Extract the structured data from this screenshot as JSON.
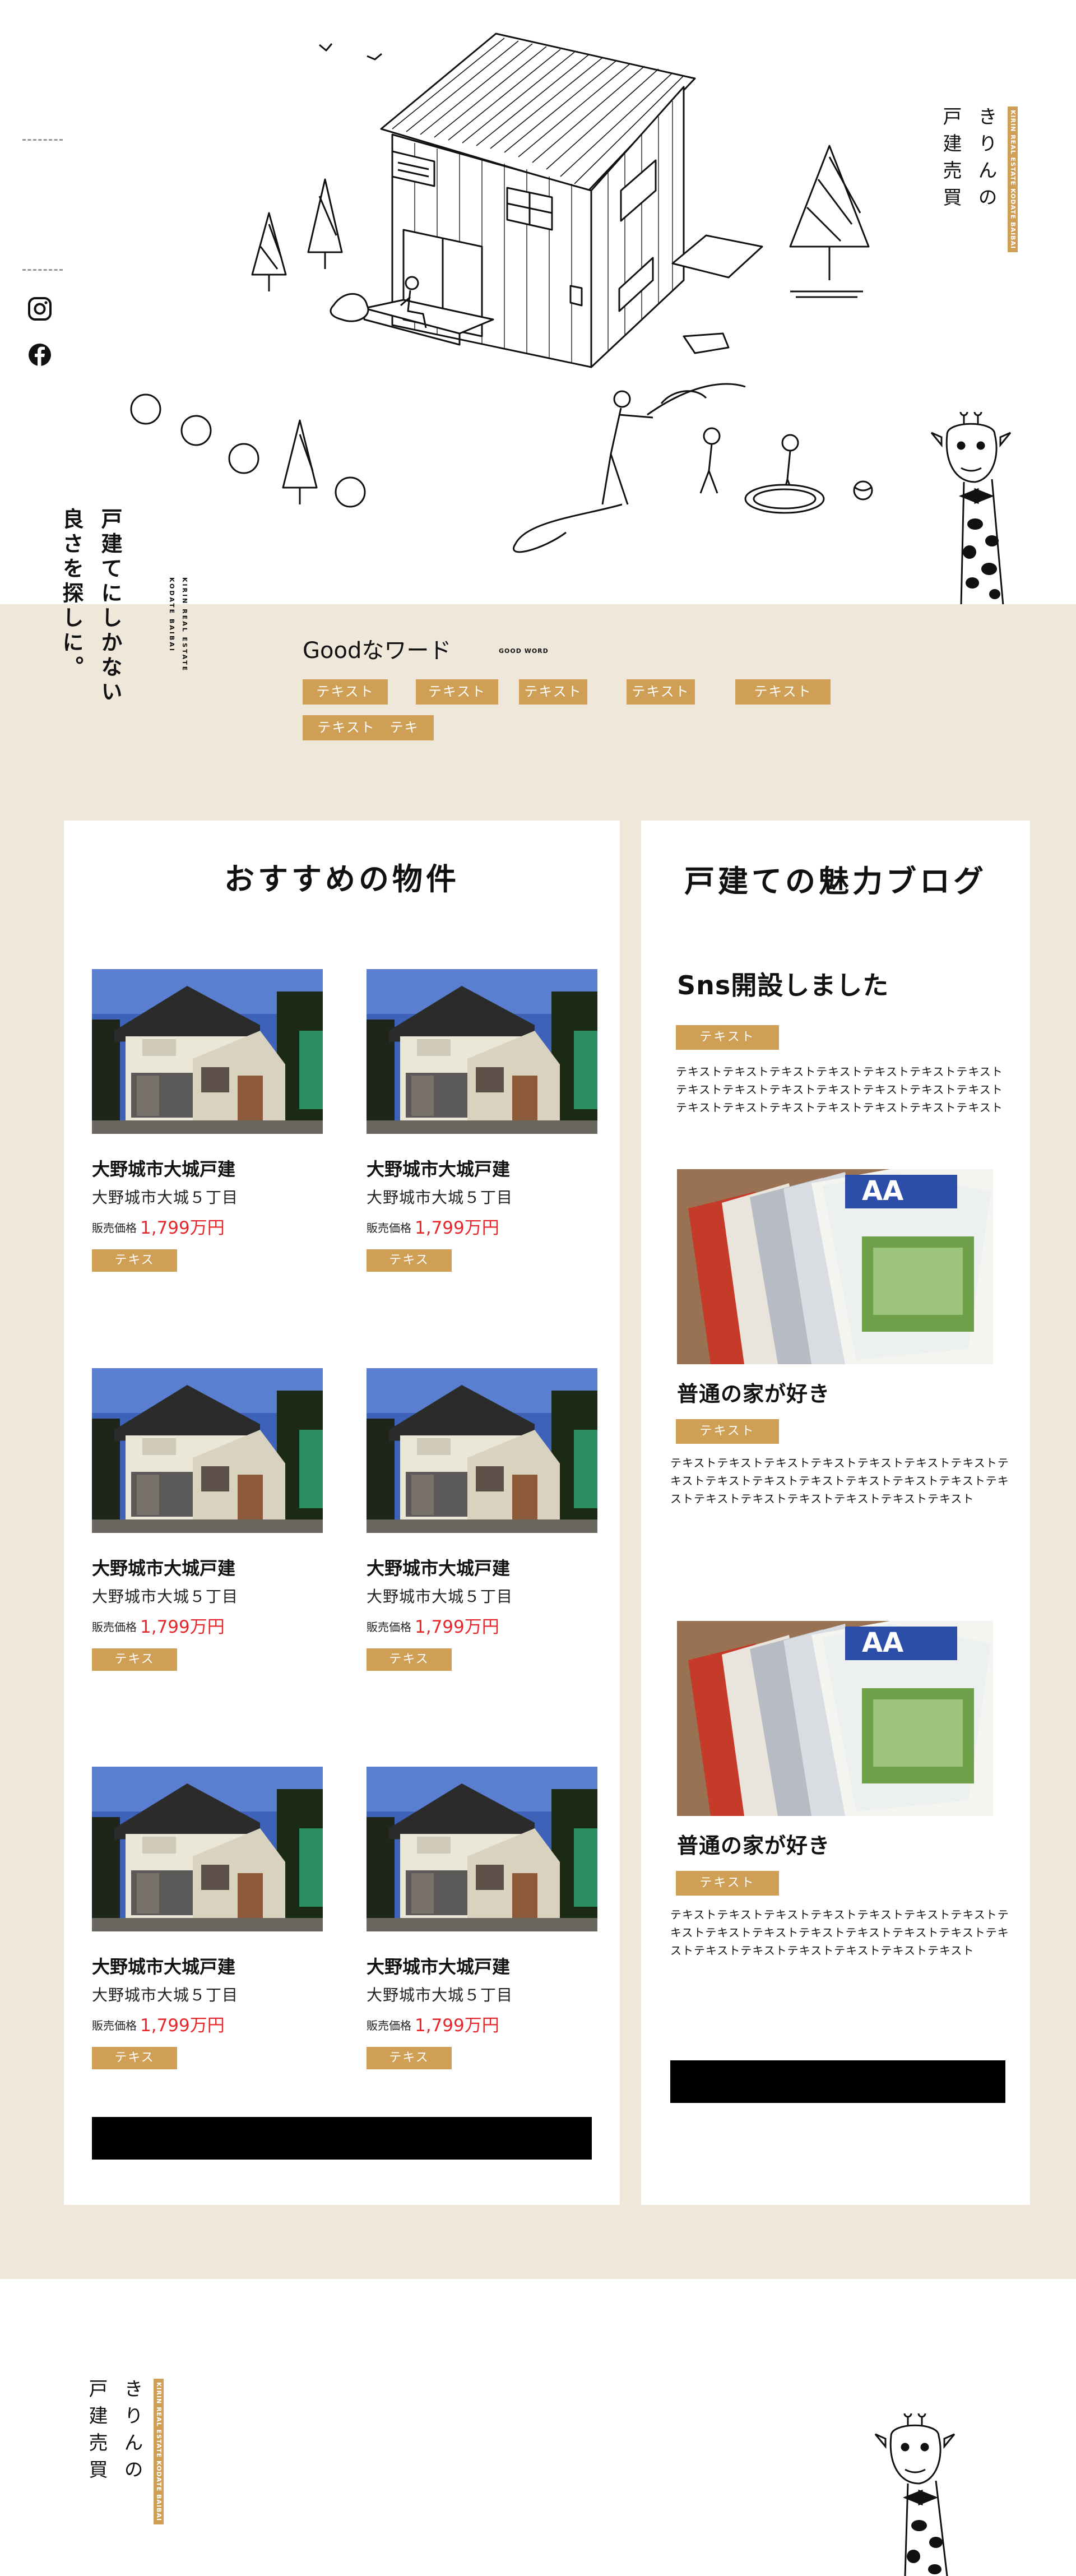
{
  "hero": {
    "social": {
      "instagram_icon": "instagram-icon",
      "facebook_icon": "facebook-icon"
    },
    "logo": {
      "col1": "きりんの",
      "col2": "戸建売買",
      "tag": "KIRIN REAL ESTATE KODATE BAIBAI"
    },
    "catch": {
      "line1": "戸建てにしかない",
      "line2": "良さを探しに。"
    },
    "catch_roman": {
      "line1": "KIRIN REAL ESTATE",
      "line2": "KODATE BAIBAI"
    }
  },
  "good_word": {
    "title": "Goodなワード",
    "subtitle": "GOOD WORD",
    "tags": [
      "テキスト",
      "テキスト",
      "テキスト",
      "テキスト",
      "テキスト",
      "テキスト　テキ"
    ]
  },
  "recommended": {
    "title": "おすすめの物件",
    "properties": [
      {
        "name": "大野城市大城戸建",
        "address": "大野城市大城５丁目",
        "price_label": "販売価格",
        "price": "1,799万円",
        "tag": "テキス"
      },
      {
        "name": "大野城市大城戸建",
        "address": "大野城市大城５丁目",
        "price_label": "販売価格",
        "price": "1,799万円",
        "tag": "テキス"
      },
      {
        "name": "大野城市大城戸建",
        "address": "大野城市大城５丁目",
        "price_label": "販売価格",
        "price": "1,799万円",
        "tag": "テキス"
      },
      {
        "name": "大野城市大城戸建",
        "address": "大野城市大城５丁目",
        "price_label": "販売価格",
        "price": "1,799万円",
        "tag": "テキス"
      },
      {
        "name": "大野城市大城戸建",
        "address": "大野城市大城５丁目",
        "price_label": "販売価格",
        "price": "1,799万円",
        "tag": "テキス"
      },
      {
        "name": "大野城市大城戸建",
        "address": "大野城市大城５丁目",
        "price_label": "販売価格",
        "price": "1,799万円",
        "tag": "テキス"
      }
    ]
  },
  "blog": {
    "title": "戸建ての魅力ブログ",
    "posts": [
      {
        "title": "Sns開設しました",
        "tag": "テキスト",
        "text": "テキストテキストテキストテキストテキストテキストテキストテキストテキストテキストテキストテキストテキストテキストテキストテキストテキストテキストテキストテキストテキスト"
      },
      {
        "title": "普通の家が好き",
        "tag": "テキスト",
        "text": "テキストテキストテキストテキストテキストテキストテキストテキストテキストテキストテキストテキストテキストテキストテキストテキストテキストテキストテキストテキストテキスト"
      },
      {
        "title": "普通の家が好き",
        "tag": "テキスト",
        "text": "テキストテキストテキストテキストテキストテキストテキストテキストテキストテキストテキストテキストテキストテキストテキストテキストテキストテキストテキストテキストテキスト"
      }
    ]
  },
  "footer": {
    "logo": {
      "col1": "きりんの",
      "col2": "戸建売買",
      "tag": "KIRIN REAL ESTATE KODATE BAIBAI"
    }
  },
  "colors": {
    "accent": "#cf9f55",
    "beige": "#efe8da",
    "price": "#e8262a"
  }
}
